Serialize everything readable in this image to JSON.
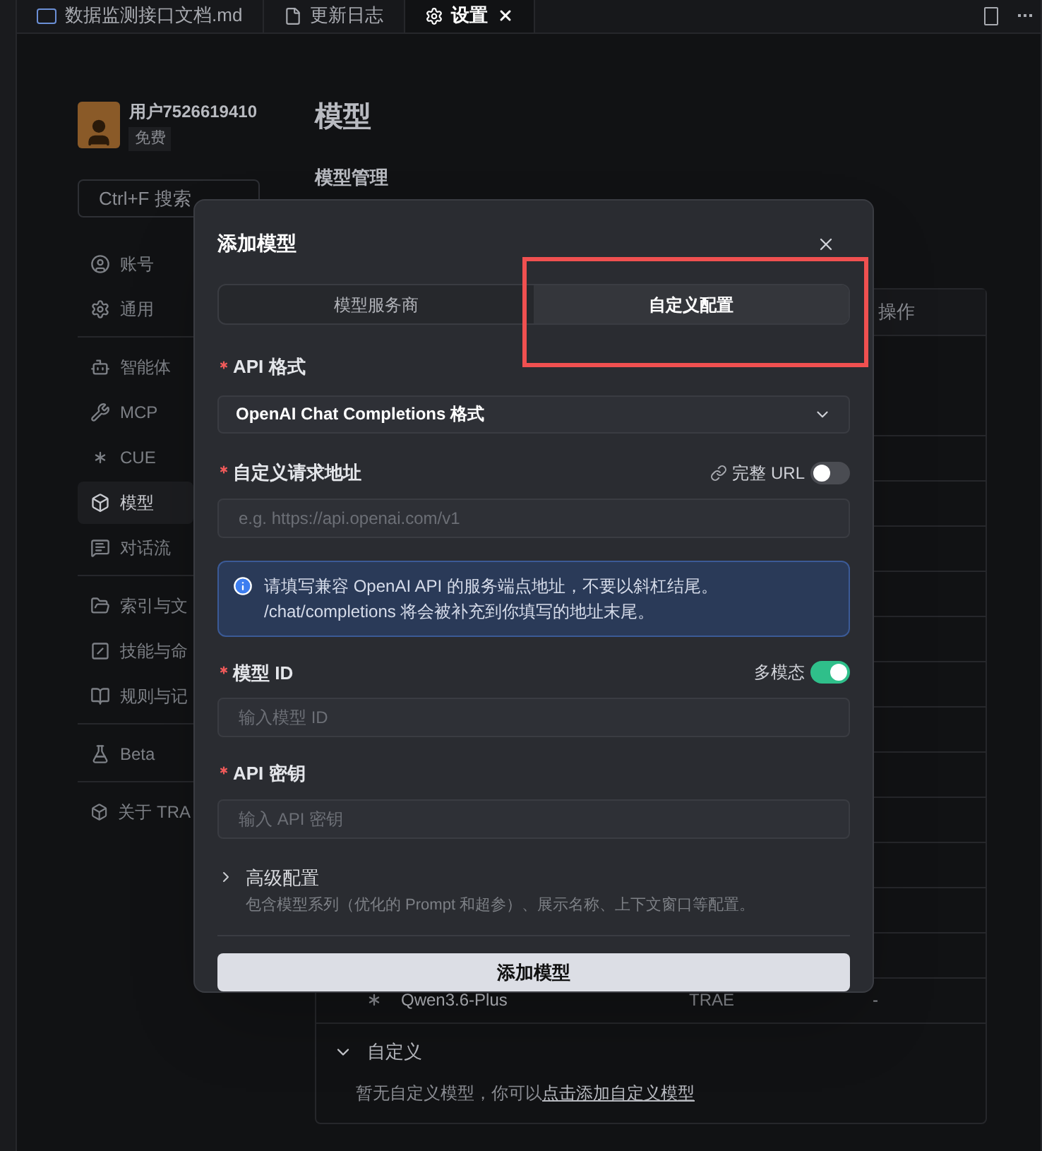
{
  "editor_tabs": [
    {
      "label": "数据监测接口文档.md",
      "kind": "markdown",
      "selected": false
    },
    {
      "label": "更新日志",
      "kind": "file",
      "selected": false
    },
    {
      "label": "设置",
      "kind": "settings",
      "selected": true
    }
  ],
  "sidebar": {
    "user": {
      "name": "用户7526619410",
      "plan": "免费"
    },
    "search": {
      "placeholder": "Ctrl+F 搜索"
    },
    "groups": [
      [
        {
          "label": "账号",
          "selected": false
        },
        {
          "label": "通用",
          "selected": false
        }
      ],
      [
        {
          "label": "智能体",
          "selected": false
        },
        {
          "label": "MCP",
          "selected": false
        },
        {
          "label": "CUE",
          "selected": false
        },
        {
          "label": "模型",
          "selected": true
        },
        {
          "label": "对话流",
          "selected": false
        }
      ],
      [
        {
          "label": "索引与文",
          "selected": false
        },
        {
          "label": "技能与命",
          "selected": false
        },
        {
          "label": "规则与记",
          "selected": false
        }
      ],
      [
        {
          "label": "Beta",
          "selected": false
        }
      ],
      [
        {
          "label": "关于 TRA",
          "selected": false
        }
      ]
    ]
  },
  "page": {
    "title": "模型",
    "section": "模型管理",
    "table": {
      "columns": [
        "操作"
      ],
      "rows": [
        {
          "name": "Qwen3.6-Plus",
          "provider": "TRAE",
          "column_3": "-"
        }
      ]
    },
    "custom_group": {
      "label": "自定义",
      "expanded": true,
      "empty_text": "暂无自定义模型，你可以",
      "link": "点击添加自定义模型"
    }
  },
  "dialog": {
    "title": "添加模型",
    "tabs": [
      {
        "label": "模型服务商",
        "selected": false
      },
      {
        "label": "自定义配置",
        "selected": true
      }
    ],
    "api_format": {
      "label": "API 格式",
      "required": true,
      "value": "OpenAI Chat Completions 格式"
    },
    "endpoint": {
      "label": "自定义请求地址",
      "required": true,
      "toggle": {
        "label": "完整 URL",
        "on": false
      },
      "placeholder": "e.g. https://api.openai.com/v1"
    },
    "info": [
      "请填写兼容 OpenAI API 的服务端点地址，不要以斜杠结尾。",
      "/chat/completions 将会被补充到你填写的地址末尾。"
    ],
    "model_id": {
      "label": "模型 ID",
      "required": true,
      "toggle": {
        "label": "多模态",
        "on": true
      },
      "placeholder": "输入模型 ID"
    },
    "api_key": {
      "label": "API 密钥",
      "required": true,
      "placeholder": "输入 API 密钥"
    },
    "advanced": {
      "label": "高级配置",
      "expanded": false,
      "description": "包含模型系列（优化的 Prompt 和超参）、展示名称、上下文窗口等配置。"
    },
    "submit": "添加模型"
  }
}
